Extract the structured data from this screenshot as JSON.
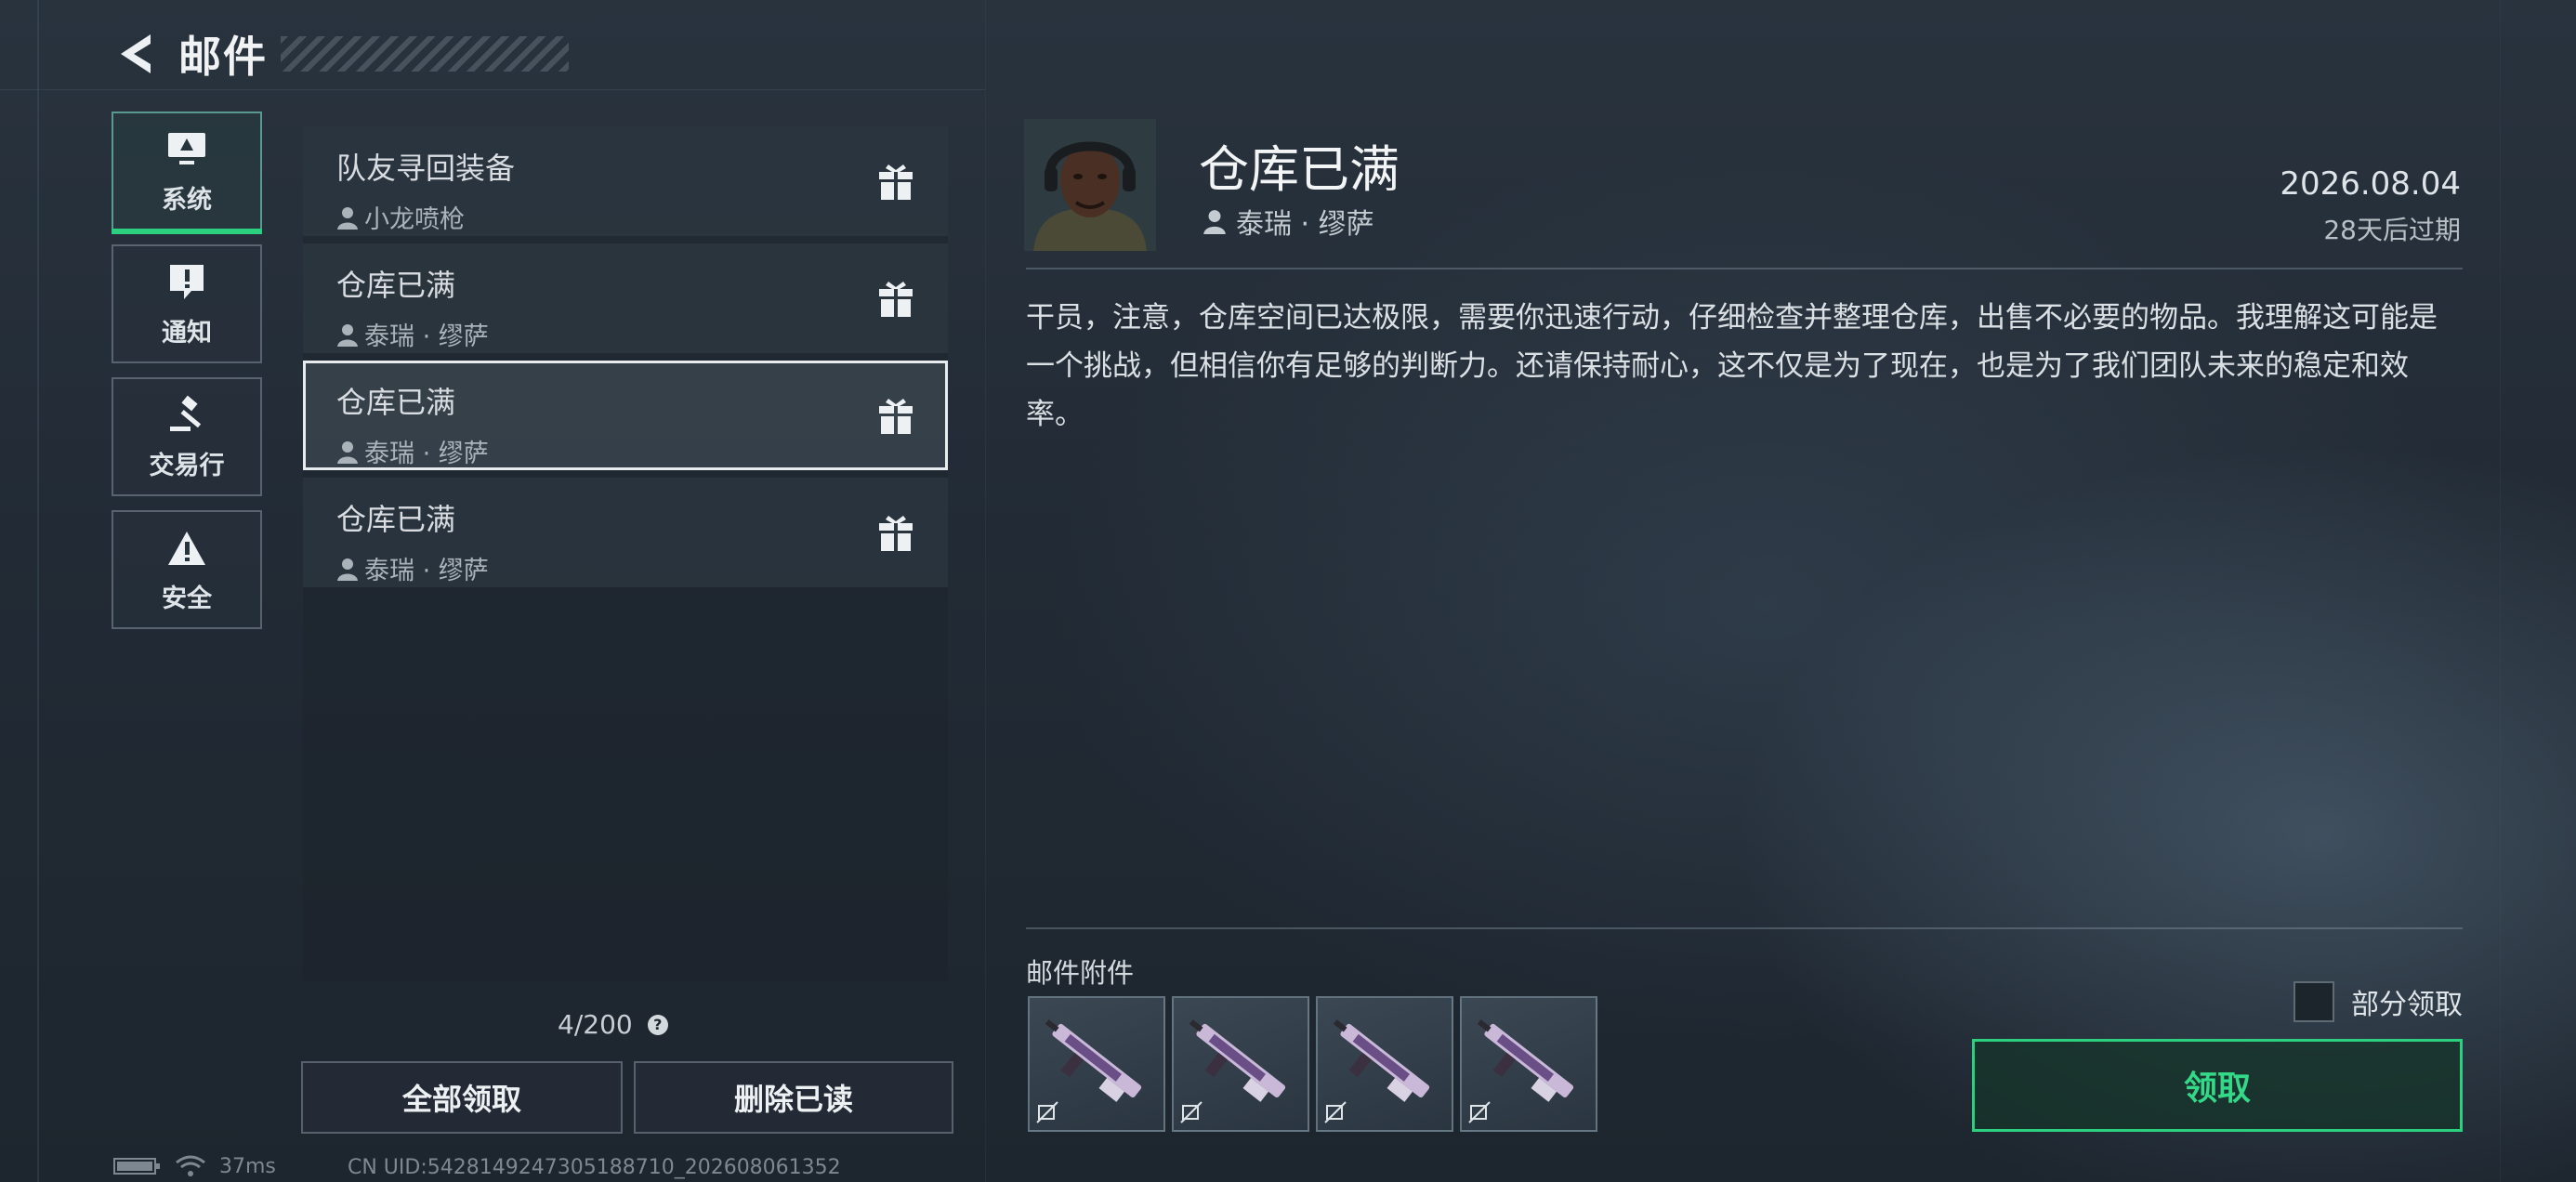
{
  "header": {
    "title": "邮件"
  },
  "categories": [
    {
      "label": "系统",
      "icon": "monitor-icon",
      "active": true
    },
    {
      "label": "通知",
      "icon": "alert-bubble-icon",
      "active": false
    },
    {
      "label": "交易行",
      "icon": "gavel-icon",
      "active": false
    },
    {
      "label": "安全",
      "icon": "warning-triangle-icon",
      "active": false
    }
  ],
  "mails": [
    {
      "title": "队友寻回装备",
      "sender": "小龙喷枪",
      "icon": "gift-icon",
      "selected": false
    },
    {
      "title": "仓库已满",
      "sender": "泰瑞 · 缪萨",
      "icon": "gift-icon",
      "selected": false
    },
    {
      "title": "仓库已满",
      "sender": "泰瑞 · 缪萨",
      "icon": "gift-icon",
      "selected": true
    },
    {
      "title": "仓库已满",
      "sender": "泰瑞 · 缪萨",
      "icon": "gift-icon",
      "selected": false
    }
  ],
  "mail_count": "4/200",
  "help_glyph": "?",
  "actions": {
    "claim_all": "全部领取",
    "delete_read": "删除已读"
  },
  "status": {
    "ping": "37ms",
    "uid": "CN UID:5428149247305188710_202608061352"
  },
  "detail": {
    "title": "仓库已满",
    "sender": "泰瑞 · 缪萨",
    "date": "2026.08.04",
    "expire": "28天后过期",
    "body": "干员，注意，仓库空间已达极限，需要你迅速行动，仔细检查并整理仓库，出售不必要的物品。我理解这可能是一个挑战，但相信你有足够的判断力。还请保持耐心，这不仅是为了现在，也是为了我们团队未来的稳定和效率。",
    "attachments_label": "邮件附件",
    "attachments": [
      {
        "icon": "rifle-icon",
        "tag": "untradeable-icon"
      },
      {
        "icon": "rifle-icon",
        "tag": "untradeable-icon"
      },
      {
        "icon": "rifle-icon",
        "tag": "untradeable-icon"
      },
      {
        "icon": "rifle-icon",
        "tag": "untradeable-icon"
      }
    ],
    "partial_claim": "部分领取",
    "claim": "领取"
  },
  "colors": {
    "accent_green": "#2bd17e",
    "selected_border": "#e9ecef"
  }
}
